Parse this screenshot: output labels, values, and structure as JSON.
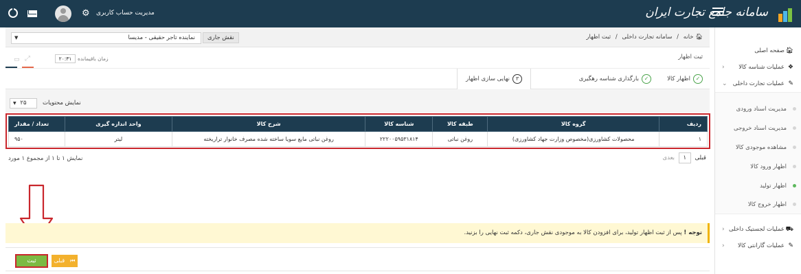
{
  "header": {
    "logo_text": "سامانه جامع تجارت ایران",
    "account_label": "مدیریت حساب کاربری",
    "icons": [
      "power-icon",
      "mail-icon",
      "avatar-icon",
      "gear-icon",
      "hamburger-icon"
    ]
  },
  "breadcrumb": {
    "home": "خانه",
    "sep1": "/",
    "section": "سامانه تجارت داخلی",
    "sep2": "/",
    "page": "ثبت اظهار"
  },
  "role": {
    "label": "نقش جاری",
    "value": "نماینده تاجر حقیقی - مدیسا"
  },
  "page": {
    "title": "ثبت اظهار",
    "timer_label": "زمان باقیمانده",
    "timer_value": "۲۰:۳۱"
  },
  "steps": [
    {
      "label": "اظهار کالا",
      "state": "done"
    },
    {
      "label": "بارگذاری شناسه رهگیری",
      "state": "done"
    },
    {
      "label": "نهایی سازی اظهار",
      "state": "active",
      "number": "۳"
    }
  ],
  "listing": {
    "show_label": "نمایش محتویات",
    "page_size": "۲۵",
    "info": "نمایش ۱ تا ۱ از مجموع ۱ مورد",
    "pager_prev": "قبلی",
    "pager_page": "۱",
    "pager_next": "بعدی"
  },
  "table": {
    "headers": [
      "ردیف",
      "گروه کالا",
      "طبقه کالا",
      "شناسه کالا",
      "شرح کالا",
      "واحد اندازه گیری",
      "تعداد / مقدار"
    ],
    "rows": [
      [
        "۱",
        "محصولات کشاورزی(مخصوص وزارت جهاد کشاورزی)",
        "روغن نباتی",
        "۲۲۲۰۰۵۹۵۳۱۸۱۴",
        "روغن نباتی مایع سویا ساخته شده مصرف خانوار تراریخته",
        "لیتر",
        "۹۵۰"
      ]
    ]
  },
  "notice": {
    "title": "توجه !",
    "text": "پس از ثبت اظهار تولید، برای افزودن کالا به موجودی نقش جاری، دکمه ثبت نهایی را بزنید."
  },
  "actions": {
    "prev_label": "قبلی",
    "save_label": "ثبت"
  },
  "sidebar": {
    "items": [
      {
        "label": "صفحه اصلی"
      },
      {
        "label": "عملیات شناسه کالا"
      },
      {
        "label": "عملیات تجارت داخلی"
      }
    ],
    "subitems": [
      {
        "label": "مدیریت اسناد ورودی"
      },
      {
        "label": "مدیریت اسناد خروجی"
      },
      {
        "label": "مشاهده موجودی کالا"
      },
      {
        "label": "اظهار ورود کالا"
      },
      {
        "label": "اظهار تولید"
      },
      {
        "label": "اظهار خروج کالا"
      }
    ],
    "bottom_items": [
      {
        "label": "عملیات لجستیک داخلی"
      },
      {
        "label": "عملیات گارانتی کالا"
      }
    ]
  },
  "colors": {
    "header_bg": "#1d3c50",
    "highlight_red": "#c9262c",
    "save_green": "#7cba43",
    "prev_orange": "#f3b12d",
    "notice_bg": "#fff8d3",
    "active_dot": "#5cb85c"
  }
}
